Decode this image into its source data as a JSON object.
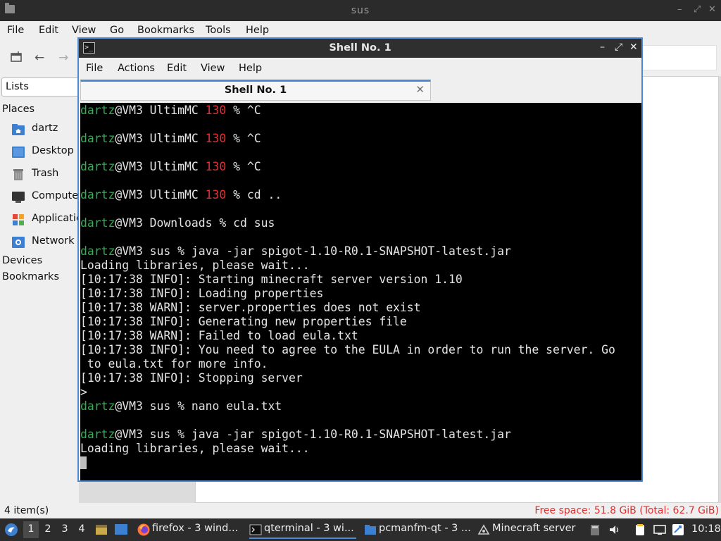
{
  "file_manager": {
    "title": "sus",
    "menu": [
      "File",
      "Edit",
      "View",
      "Go",
      "Bookmarks",
      "Tools",
      "Help"
    ],
    "side_combo": "Lists",
    "places_heading": "Places",
    "places": [
      {
        "label": "dartz",
        "icon": "home-folder-icon"
      },
      {
        "label": "Desktop",
        "icon": "desktop-icon"
      },
      {
        "label": "Trash",
        "icon": "trash-icon"
      },
      {
        "label": "Computer",
        "icon": "computer-icon"
      },
      {
        "label": "Applications",
        "icon": "applications-icon"
      },
      {
        "label": "Network",
        "icon": "network-icon"
      }
    ],
    "devices_heading": "Devices",
    "bookmarks_heading": "Bookmarks",
    "status_left": "4 item(s)",
    "status_right": "Free space: 51.8 GiB (Total: 62.7 GiB)"
  },
  "terminal": {
    "title": "Shell No. 1",
    "menu": [
      "File",
      "Actions",
      "Edit",
      "View",
      "Help"
    ],
    "tab_label": "Shell No. 1",
    "colors": {
      "prompt_user": "#2bb24c",
      "exit_code": "#e03030",
      "text": "#e4e4e4",
      "background": "#000000"
    },
    "lines": [
      {
        "user": "dartz",
        "host": "@VM3 UltimMC ",
        "code": "130",
        "rest": " % ^C"
      },
      {
        "text": ""
      },
      {
        "user": "dartz",
        "host": "@VM3 UltimMC ",
        "code": "130",
        "rest": " % ^C"
      },
      {
        "text": ""
      },
      {
        "user": "dartz",
        "host": "@VM3 UltimMC ",
        "code": "130",
        "rest": " % ^C"
      },
      {
        "text": ""
      },
      {
        "user": "dartz",
        "host": "@VM3 UltimMC ",
        "code": "130",
        "rest": " % cd .."
      },
      {
        "text": ""
      },
      {
        "user": "dartz",
        "host": "@VM3 Downloads % cd sus"
      },
      {
        "text": ""
      },
      {
        "user": "dartz",
        "host": "@VM3 sus % java -jar spigot-1.10-R0.1-SNAPSHOT-latest.jar"
      },
      {
        "text": "Loading libraries, please wait..."
      },
      {
        "text": "[10:17:38 INFO]: Starting minecraft server version 1.10"
      },
      {
        "text": "[10:17:38 INFO]: Loading properties"
      },
      {
        "text": "[10:17:38 WARN]: server.properties does not exist"
      },
      {
        "text": "[10:17:38 INFO]: Generating new properties file"
      },
      {
        "text": "[10:17:38 WARN]: Failed to load eula.txt"
      },
      {
        "text": "[10:17:38 INFO]: You need to agree to the EULA in order to run the server. Go"
      },
      {
        "text": " to eula.txt for more info."
      },
      {
        "text": "[10:17:38 INFO]: Stopping server"
      },
      {
        "text": ">"
      },
      {
        "user": "dartz",
        "host": "@VM3 sus % nano eula.txt"
      },
      {
        "text": ""
      },
      {
        "user": "dartz",
        "host": "@VM3 sus % java -jar spigot-1.10-R0.1-SNAPSHOT-latest.jar"
      },
      {
        "text": "Loading libraries, please wait..."
      },
      {
        "cursor": true
      }
    ]
  },
  "taskbar": {
    "workspaces": [
      "1",
      "2",
      "3",
      "4"
    ],
    "active_workspace": "1",
    "tasks": [
      {
        "label": "firefox - 3 wind...",
        "icon": "firefox-icon"
      },
      {
        "label": "qterminal - 3 wi...",
        "icon": "terminal-icon"
      },
      {
        "label": "pcmanfm-qt - 3 ...",
        "icon": "folder-icon"
      },
      {
        "label": "Minecraft server",
        "icon": "minecraft-icon"
      }
    ],
    "clock": "10:18"
  }
}
